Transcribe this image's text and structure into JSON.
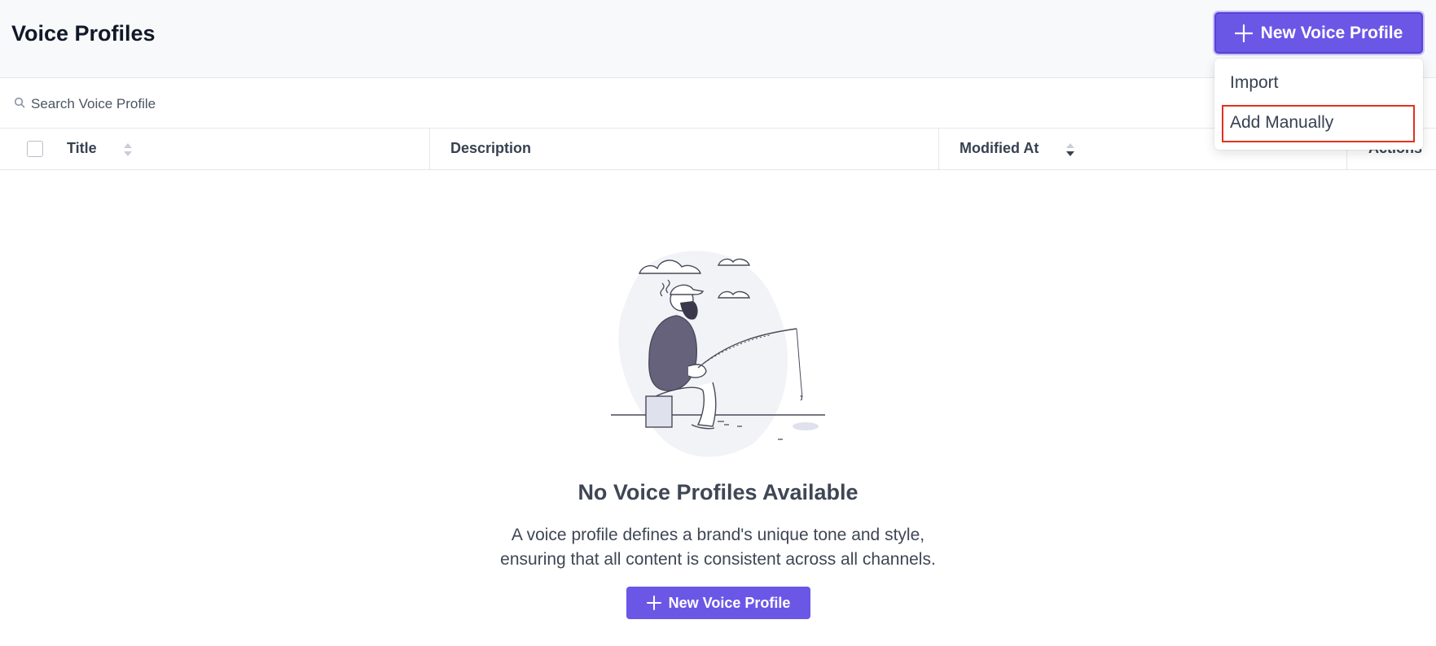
{
  "header": {
    "title": "Voice Profiles",
    "new_button_label": "New Voice Profile"
  },
  "search": {
    "placeholder": "Search Voice Profile"
  },
  "table": {
    "columns": [
      "Title",
      "Description",
      "Modified At",
      "Actions"
    ]
  },
  "empty_state": {
    "title": "No Voice Profiles Available",
    "description_line1": "A voice profile defines a brand's unique tone and style,",
    "description_line2": "ensuring that all content is consistent across all channels.",
    "button_label": "New Voice Profile"
  },
  "dropdown": {
    "items": [
      "Import",
      "Add Manually"
    ]
  },
  "colors": {
    "accent": "#6b57e6",
    "highlight": "#e0321f"
  },
  "icons": [
    "plus-icon",
    "search-icon",
    "sort-icon",
    "sort-desc-icon"
  ]
}
